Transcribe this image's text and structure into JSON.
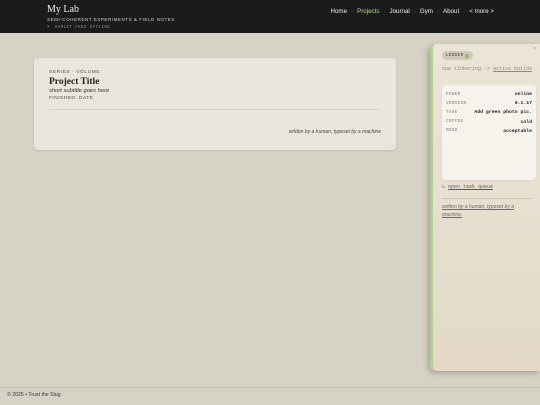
{
  "header": {
    "title": "My Lab",
    "subtitle": "SEMI-COHERENT EXPERIMENTS & FIELD NOTES",
    "feed_status": "HAMLET FEED OFFLINE",
    "feed_chevron": ">"
  },
  "nav": {
    "items": [
      "Home",
      "Projects",
      "Journal",
      "Gym",
      "About",
      "< more >"
    ],
    "active": "Projects",
    "separator": "·"
  },
  "project": {
    "series": "SERIES · VOLUME",
    "title": "Project Title",
    "subtitle": "short subtitle goes here",
    "finished": "FINISHED: DATE",
    "signature": "written by a human, typeset by a machine"
  },
  "ledger": {
    "badge": "LEDGER",
    "note_prefix": "now tinkering -> ",
    "note_link": "active builds",
    "rows": [
      {
        "key": "POWER",
        "value": "online"
      },
      {
        "key": "VERSION",
        "value": "0.1.17"
      },
      {
        "key": "TASK",
        "value": "Add green photo pic."
      },
      {
        "key": "COFFEE",
        "value": "cold"
      },
      {
        "key": "MOOD",
        "value": "acceptable"
      }
    ],
    "open_queue": "open task queue",
    "open_queue_glyph": "↳",
    "signature": "written by a human, typeset by a machine."
  },
  "footer": {
    "text": "© 2025 • Trust the Slug"
  },
  "colors": {
    "accent": "#b9d98c",
    "header_bg": "#1b1b1b",
    "page_bg": "#d6d2c6"
  }
}
